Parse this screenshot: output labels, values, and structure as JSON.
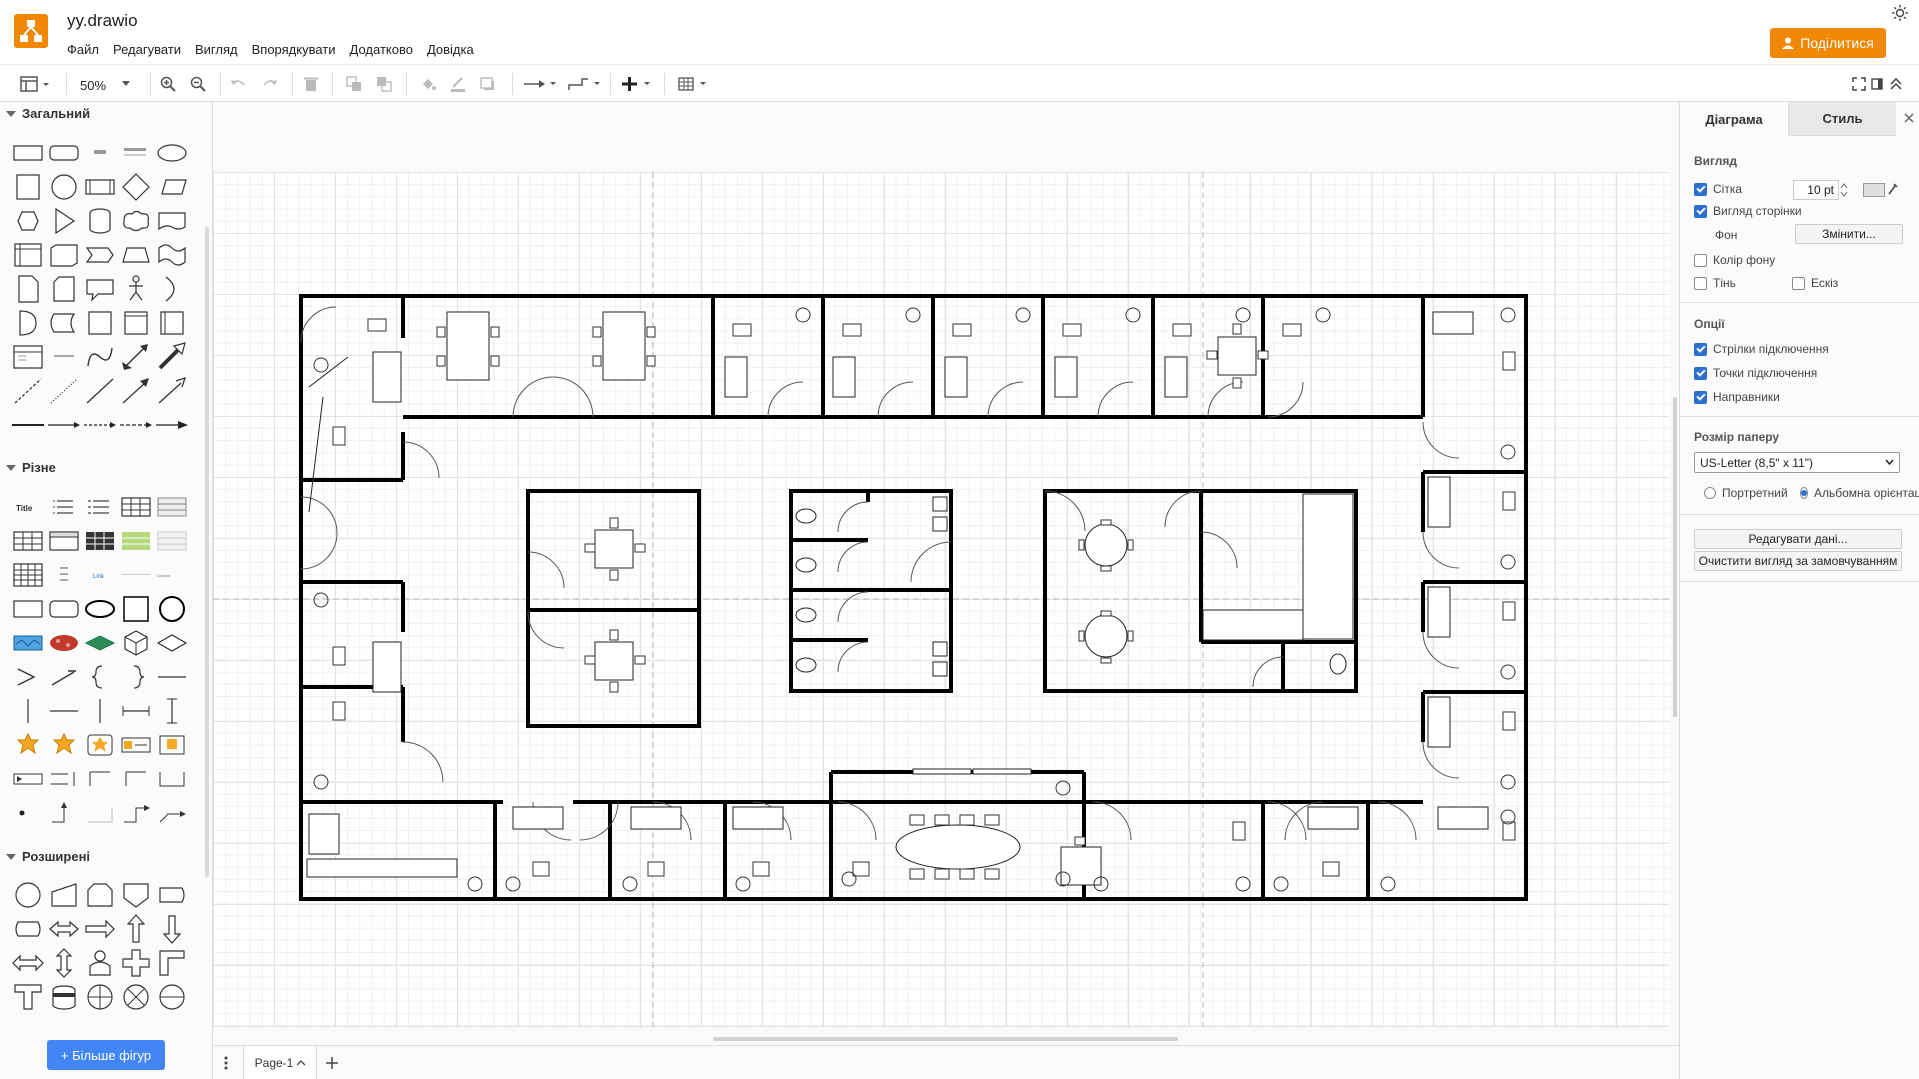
{
  "app": {
    "title": "yy.drawio",
    "menus": [
      "Файл",
      "Редагувати",
      "Вигляд",
      "Впорядкувати",
      "Додатково",
      "Довідка"
    ],
    "share_label": "Поділитися",
    "brand_color": "#f08705"
  },
  "toolbar": {
    "zoom": "50%",
    "icons": [
      "format-panel-icon",
      "zoom-in-icon",
      "zoom-out-icon",
      "undo-icon",
      "redo-icon",
      "delete-icon",
      "to-front-icon",
      "to-back-icon",
      "fill-color-icon",
      "line-color-icon",
      "shadow-icon",
      "connection-icon",
      "waypoints-icon",
      "insert-icon",
      "table-icon",
      "fullscreen-icon",
      "split-panel-icon",
      "collapse-icon"
    ]
  },
  "sidebar": {
    "sections": [
      {
        "title": "Загальний"
      },
      {
        "title": "Різне"
      },
      {
        "title": "Розширені"
      }
    ],
    "more_shapes_label": "+ Більше фігур",
    "accent_color": "#4285f4"
  },
  "pages": {
    "current": "Page-1"
  },
  "format_panel": {
    "tabs": [
      "Діаграма",
      "Стиль"
    ],
    "view": {
      "title": "Вигляд",
      "grid_label": "Сітка",
      "grid_size": "10 pt",
      "page_view_label": "Вигляд сторінки",
      "background_label": "Фон",
      "change_label": "Змінити...",
      "bg_color_label": "Колір фону",
      "shadow_label": "Тінь",
      "sketch_label": "Ескіз"
    },
    "options": {
      "title": "Опції",
      "arrows_label": "Стрілки підключення",
      "points_label": "Точки підключення",
      "guides_label": "Направники"
    },
    "paper": {
      "title": "Розмір паперу",
      "selected": "US-Letter (8,5\" x 11\")",
      "portrait_label": "Портретний",
      "landscape_label": "Альбомна орієнтація"
    },
    "edit_data_label": "Редагувати дані...",
    "clear_view_label": "Очистити вигляд за замовчуванням"
  }
}
